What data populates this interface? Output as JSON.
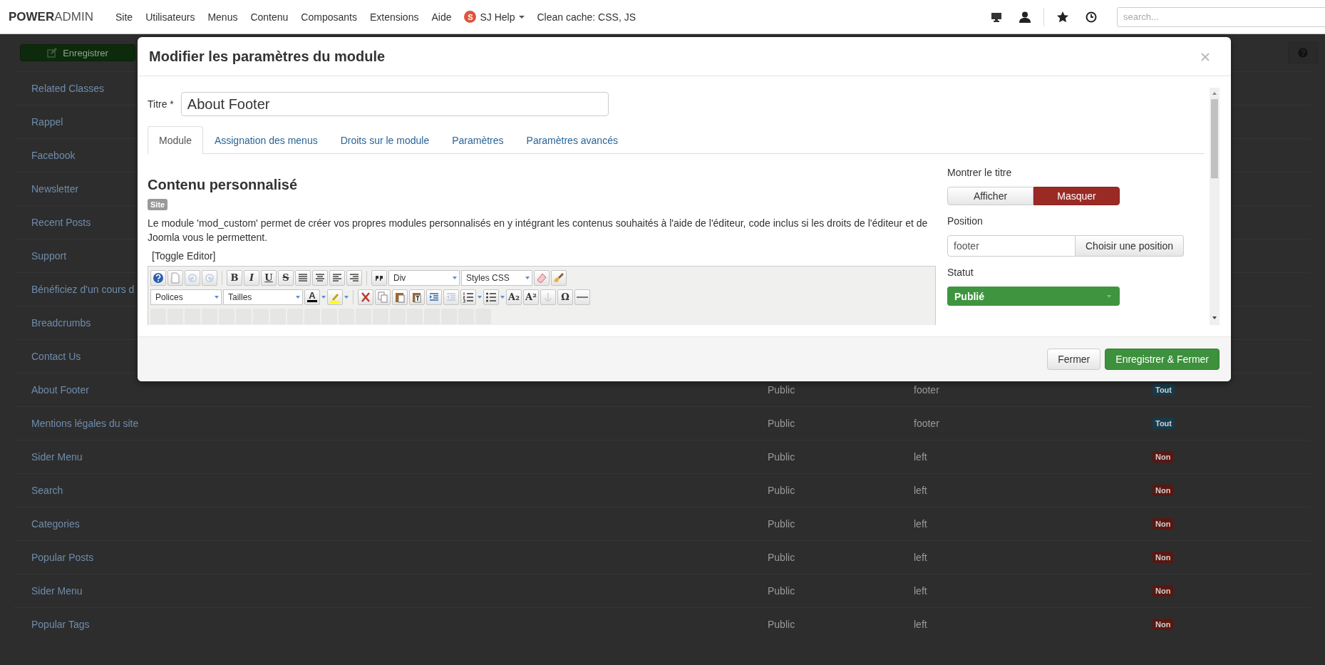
{
  "navbar": {
    "logo": "**POWER**ADMIN",
    "menu": [
      {
        "label": "Site",
        "kind": "plain"
      },
      {
        "label": "Utilisateurs",
        "kind": "plain"
      },
      {
        "label": "Menus",
        "kind": "plain"
      },
      {
        "label": "Contenu",
        "kind": "plain"
      },
      {
        "label": "Composants",
        "kind": "plain"
      },
      {
        "label": "Extensions",
        "kind": "plain"
      },
      {
        "label": "Aide",
        "kind": "plain"
      },
      {
        "label": "SJ Help",
        "kind": "dropdown",
        "icon_letter": "S"
      },
      {
        "label": "Clean cache: CSS, JS",
        "kind": "plain"
      }
    ],
    "search": {
      "placeholder": "search..."
    }
  },
  "toolbar": {
    "save_button": "Enregistrer"
  },
  "modules": [
    {
      "title": "Related Classes"
    },
    {
      "title": "Rappel"
    },
    {
      "title": "Facebook"
    },
    {
      "title": "Newsletter"
    },
    {
      "title": "Recent Posts"
    },
    {
      "title": "Support"
    },
    {
      "title": "Bénéficiez d'un cours d"
    },
    {
      "title": "Breadcrumbs"
    },
    {
      "title": "Contact Us"
    },
    {
      "title": "About Footer",
      "access": "Public",
      "position": "footer",
      "pages": {
        "text": "Tout",
        "color": "#163a4a"
      }
    },
    {
      "title": "Mentions légales du site",
      "access": "Public",
      "position": "footer",
      "pages": {
        "text": "Tout",
        "color": "#163a4a"
      }
    },
    {
      "title": "Sider Menu",
      "access": "Public",
      "position": "left",
      "pages": {
        "text": "Non",
        "color": "#5a1712"
      }
    },
    {
      "title": "Search",
      "access": "Public",
      "position": "left",
      "pages": {
        "text": "Non",
        "color": "#5a1712"
      }
    },
    {
      "title": "Categories",
      "access": "Public",
      "position": "left",
      "pages": {
        "text": "Non",
        "color": "#5a1712"
      }
    },
    {
      "title": "Popular Posts",
      "access": "Public",
      "position": "left",
      "pages": {
        "text": "Non",
        "color": "#5a1712"
      }
    },
    {
      "title": "Sider Menu",
      "access": "Public",
      "position": "left",
      "pages": {
        "text": "Non",
        "color": "#5a1712"
      }
    },
    {
      "title": "Popular Tags",
      "access": "Public",
      "position": "left",
      "pages": {
        "text": "Non",
        "color": "#5a1712"
      }
    }
  ],
  "modal": {
    "title": "Modifier les paramètres du module",
    "title_field": {
      "label": "Titre *",
      "value": "About Footer"
    },
    "tabs": [
      {
        "label": "Module",
        "selected": true
      },
      {
        "label": "Assignation des menus",
        "selected": false
      },
      {
        "label": "Droits sur le module",
        "selected": false
      },
      {
        "label": "Paramètres",
        "selected": false
      },
      {
        "label": "Paramètres avancés",
        "selected": false
      }
    ],
    "content": {
      "heading": "Contenu personnalisé",
      "badge": "Site",
      "description": "Le module 'mod_custom' permet de créer vos propres modules personnalisés en y intégrant les contenus souhaités à l'aide de l'éditeur, code inclus si les droits de l'éditeur et de Joomla vous le permettent.",
      "toggle_editor": "[Toggle Editor]",
      "editor": {
        "row_1": {
          "glyphs": [
            "B",
            "I",
            "U",
            "S"
          ],
          "selects": [
            "Div",
            "Styles CSS"
          ]
        },
        "row_2": {
          "glyphs": [
            "A",
            "A₂",
            "A²",
            "Ω"
          ],
          "selects": [
            "Polices",
            "Tailles"
          ]
        }
      }
    },
    "show_title": {
      "label": "Montrer le titre",
      "options": [
        {
          "label": "Afficher",
          "selected": false
        },
        {
          "label": "Masquer",
          "selected": true
        }
      ]
    },
    "position": {
      "label": "Position",
      "value": "footer",
      "button": "Choisir une position"
    },
    "status": {
      "label": "Statut",
      "value": "Publié"
    },
    "buttons": [
      {
        "label": "Fermer",
        "kind": "default"
      },
      {
        "label": "Enregistrer & Fermer",
        "kind": "primary"
      }
    ]
  }
}
